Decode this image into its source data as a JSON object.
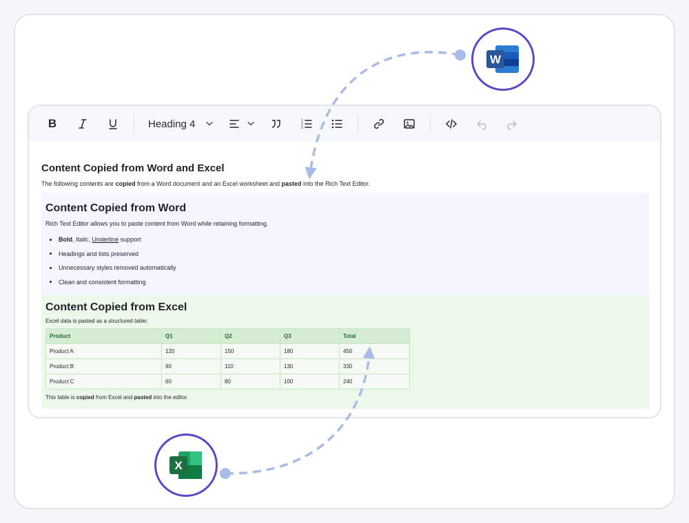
{
  "toolbar": {
    "bold_label": "B",
    "heading_value": "Heading 4"
  },
  "doc": {
    "title": "Content Copied from Word and Excel",
    "intro": {
      "part1": "The following contents are ",
      "bold1": "copied",
      "part2": " from a Word document and an Excel worksheet and ",
      "bold2": "pasted",
      "part3": " into the Rich Text Editor."
    },
    "word": {
      "title": "Content Copied from Word",
      "desc": "Rich Text Editor allows you to paste content from Word while retaining formatting.",
      "item1": {
        "bold": "Bold",
        "sep1": ", ",
        "italic": "Italic",
        "sep2": ", ",
        "underline": "Underline",
        "rest": " support"
      },
      "items": [
        "Headings and lists preserved",
        "Unnecessary styles removed automatically",
        "Clean and consistent formatting"
      ]
    },
    "excel": {
      "title": "Content Copied from Excel",
      "desc": "Excel data is pasted as a structured table:",
      "headers": [
        "Product",
        "Q1",
        "Q2",
        "Q3",
        "Total"
      ],
      "rows": [
        [
          "Product A",
          "120",
          "150",
          "180",
          "450"
        ],
        [
          "Product B",
          "90",
          "110",
          "130",
          "330"
        ],
        [
          "Product C",
          "60",
          "80",
          "100",
          "240"
        ]
      ],
      "note": {
        "part1": "This table is ",
        "bold1": "copied",
        "part2": " from Excel and ",
        "bold2": "pasted",
        "part3": " into the editor."
      }
    }
  },
  "badges": {
    "word_letter": "W",
    "excel_letter": "X"
  },
  "colors": {
    "badge_ring": "#5b46c9",
    "connector": "#a9bce6",
    "word_bg": "#f3f6fe",
    "excel_bg": "#ebf8ea",
    "word_blue": "#2b579a",
    "excel_green": "#1d6f42"
  }
}
